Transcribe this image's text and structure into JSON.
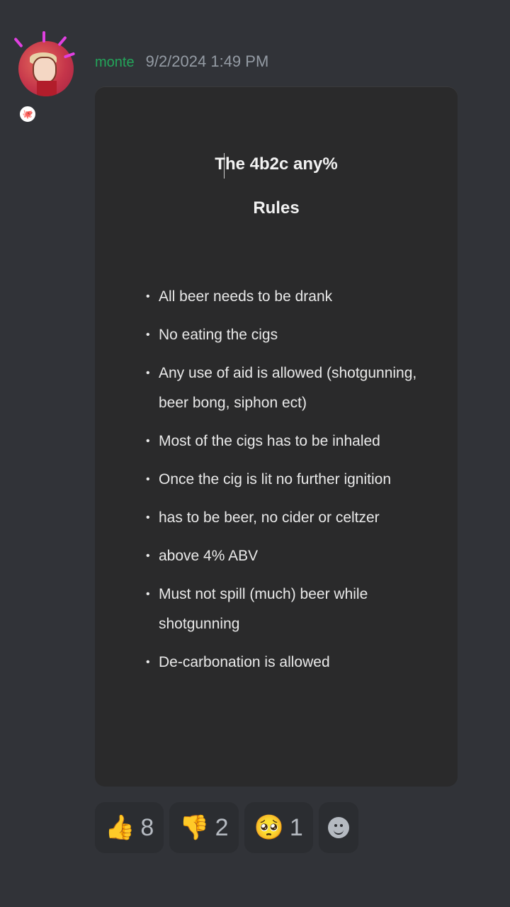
{
  "message": {
    "username": "monte",
    "timestamp": "9/2/2024 1:49 PM",
    "avatar_badge": "🐙",
    "colors": {
      "username": "#23a55a",
      "background": "#313338",
      "attachment_bg": "#2a2a2b"
    }
  },
  "attachment": {
    "title_line1": "The 4b2c any%",
    "title_line2": "Rules",
    "bullet": "•",
    "rules": [
      "All beer needs to be drank",
      "No eating the cigs",
      "Any use of aid is allowed (shotgunning, beer bong, siphon ect)",
      "Most of the cigs has to be inhaled",
      "Once the cig is lit no further ignition",
      "has to be beer, no cider or celtzer",
      "above 4% ABV",
      "Must not spill (much) beer while shotgunning",
      "De-carbonation is allowed"
    ]
  },
  "reactions": [
    {
      "emoji": "👍",
      "icon": "thumbs-up-icon",
      "count": "8"
    },
    {
      "emoji": "👎",
      "icon": "thumbs-down-icon",
      "count": "2"
    },
    {
      "emoji": "🥺",
      "icon": "pleading-face-icon",
      "count": "1"
    }
  ],
  "add_reaction_icon": "add-reaction-icon"
}
